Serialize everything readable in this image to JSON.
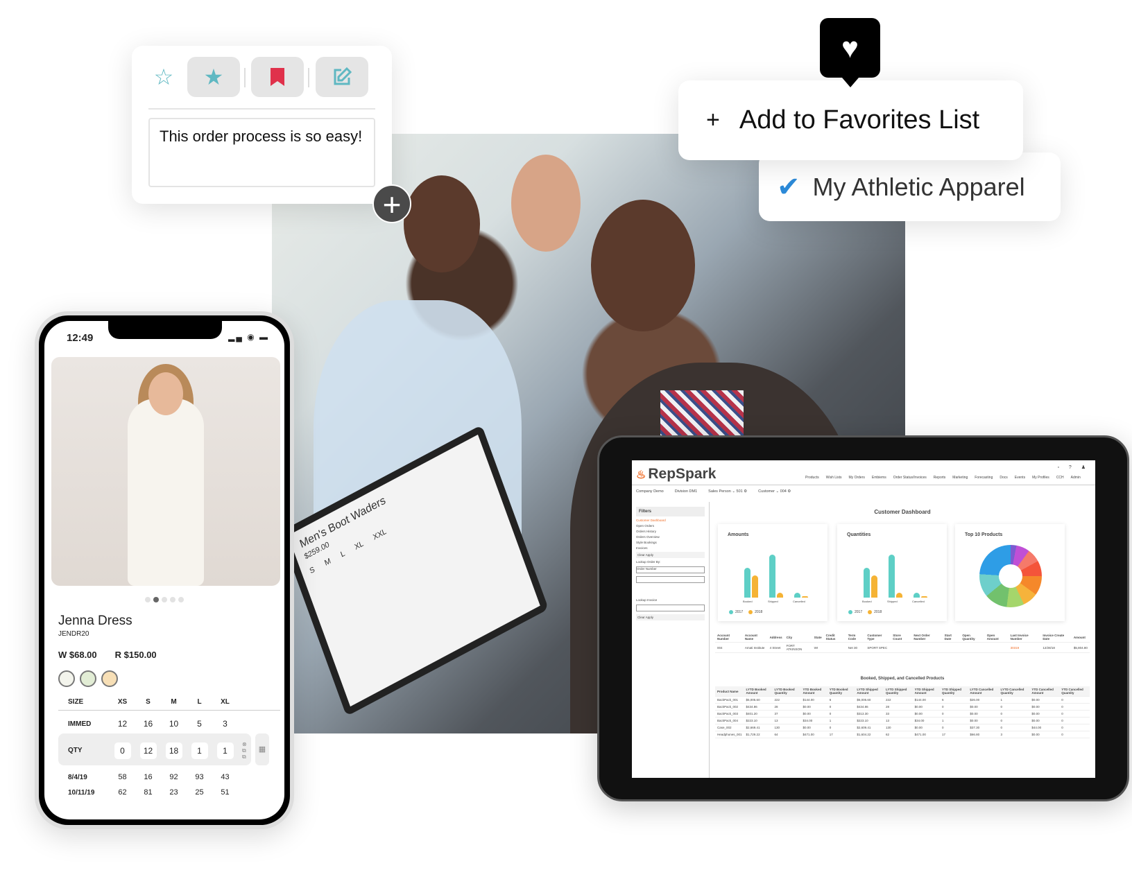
{
  "comment_card": {
    "toolbar": [
      {
        "icon": "star-outline-icon",
        "color": "#5fb8c2"
      },
      {
        "icon": "star-filled-icon",
        "color": "#5fb8c2"
      },
      {
        "icon": "bookmark-icon",
        "color": "#e0314b"
      },
      {
        "icon": "edit-icon",
        "color": "#5fb8c2"
      }
    ],
    "text": "This order process is so easy!"
  },
  "favorites": {
    "add_label": "Add to Favorites List",
    "plus": "+",
    "list_name": "My Athletic Apparel",
    "check_color": "#2c8ad8"
  },
  "laptop": {
    "title": "Men's Boot Waders",
    "price": "$259.00",
    "sizes": [
      "S",
      "M",
      "L",
      "XL",
      "XXL"
    ]
  },
  "phone": {
    "time": "12:49",
    "product_name": "Jenna Dress",
    "sku": "JENDR20",
    "wholesale": "W $68.00",
    "retail": "R $150.00",
    "swatches": [
      "#f3f4ec",
      "#e2edd5",
      "#f7dfb6"
    ],
    "sizes_label": "SIZE",
    "sizes": [
      "XS",
      "S",
      "M",
      "L",
      "XL"
    ],
    "rows": [
      {
        "label": "IMMED",
        "values": [
          "12",
          "16",
          "10",
          "5",
          "3"
        ]
      },
      {
        "label": "QTY",
        "values": [
          "0",
          "12",
          "18",
          "1",
          "1"
        ]
      },
      {
        "label": "8/4/19",
        "values": [
          "58",
          "16",
          "92",
          "93",
          "43"
        ]
      },
      {
        "label": "10/11/19",
        "values": [
          "62",
          "81",
          "23",
          "25",
          "51"
        ]
      }
    ]
  },
  "tablet": {
    "brand": "RepSpark",
    "nav": [
      "Products",
      "Wish Lists",
      "My Orders",
      "Embiems",
      "Order Status/Invoices",
      "Reports",
      "Marketing",
      "Forecasting",
      "Docs",
      "Events",
      "My Profiles",
      "CCH",
      "Admin"
    ],
    "subbar": [
      "Company Demo",
      "Division DM1",
      "Sales Person ⌄ 501 ⚙",
      "Customer ⌄ 004 ⚙"
    ],
    "filters_title": "Filters",
    "filters": [
      "Customer Dashboard",
      "Open Orders",
      "Orders History",
      "Orders Overview",
      "Style Bookings",
      "Invoices"
    ],
    "clear_apply": "Clear   Apply",
    "lookup_order_label": "Lookup Order By:",
    "lookup_order_value": "Order Number",
    "lookup_invoice_label": "Lookup Invoice",
    "title": "Customer Dashboard",
    "panels": {
      "amounts": "Amounts",
      "quantities": "Quantities",
      "top10": "Top 10 Products"
    },
    "chart_categories": [
      "Booked",
      "Shipped",
      "Cancelled"
    ],
    "legend": [
      "2017",
      "2018"
    ],
    "series_colors": [
      "#5ecfc6",
      "#f5b335"
    ],
    "account_headers": [
      "Account Number",
      "Account Name",
      "Address",
      "City",
      "State",
      "Credit Status",
      "Term Code",
      "Customer Type",
      "Store Count",
      "Next Order Number",
      "Start Date",
      "Open Quantity",
      "Open Amount",
      "Last Invoice Number",
      "Invoice Create Date",
      "Amount"
    ],
    "account_row": [
      "004",
      "Amati Institute",
      "4 Street",
      "FORT ATKINSON",
      "WI",
      "",
      "Net 30",
      "SPORT SPEC",
      "",
      "",
      "",
      "",
      "",
      "30319",
      "12/28/18",
      "$5,804.80"
    ],
    "products_title": "Booked, Shipped, and Cancelled Products",
    "product_headers": [
      "Product Name",
      "LYTD Booked Amount",
      "LYTD Booked Quantity",
      "YTD Booked Amount",
      "YTD Booked Quantity",
      "LYTD Shipped Amount",
      "LYTD Shipped Quantity",
      "YTD Shipped Amount",
      "YTD Shipped Quantity",
      "LYTD Cancelled Amount",
      "LYTD Cancelled Quantity",
      "YTD Cancelled Amount",
      "YTD Cancelled Quantity"
    ],
    "product_rows": [
      [
        "BackPack_001",
        "$5,005.60",
        "222",
        "$144.00",
        "6",
        "$5,005.60",
        "222",
        "$144.00",
        "6",
        "$26.00",
        "1",
        "$0.00",
        "0"
      ],
      [
        "BackPack_002",
        "$434.86",
        "28",
        "$0.00",
        "0",
        "$434.86",
        "28",
        "$0.00",
        "0",
        "$0.00",
        "0",
        "$0.00",
        "0"
      ],
      [
        "BackPack_003",
        "$401.20",
        "37",
        "$0.00",
        "0",
        "$313.30",
        "33",
        "$0.00",
        "0",
        "$0.00",
        "0",
        "$0.00",
        "0"
      ],
      [
        "BackPack_004",
        "$223.10",
        "13",
        "$34.00",
        "1",
        "$223.10",
        "13",
        "$34.00",
        "1",
        "$0.00",
        "0",
        "$0.00",
        "0"
      ],
      [
        "Case_002",
        "$2,669.41",
        "130",
        "$0.00",
        "0",
        "$2,609.41",
        "130",
        "$0.00",
        "0",
        "$37.30",
        "0",
        "$44.00",
        "0"
      ],
      [
        "Headphones_001",
        "$1,729.22",
        "64",
        "$471.00",
        "17",
        "$1,604.22",
        "62",
        "$471.00",
        "17",
        "$66.80",
        "3",
        "$0.00",
        "0"
      ]
    ]
  }
}
